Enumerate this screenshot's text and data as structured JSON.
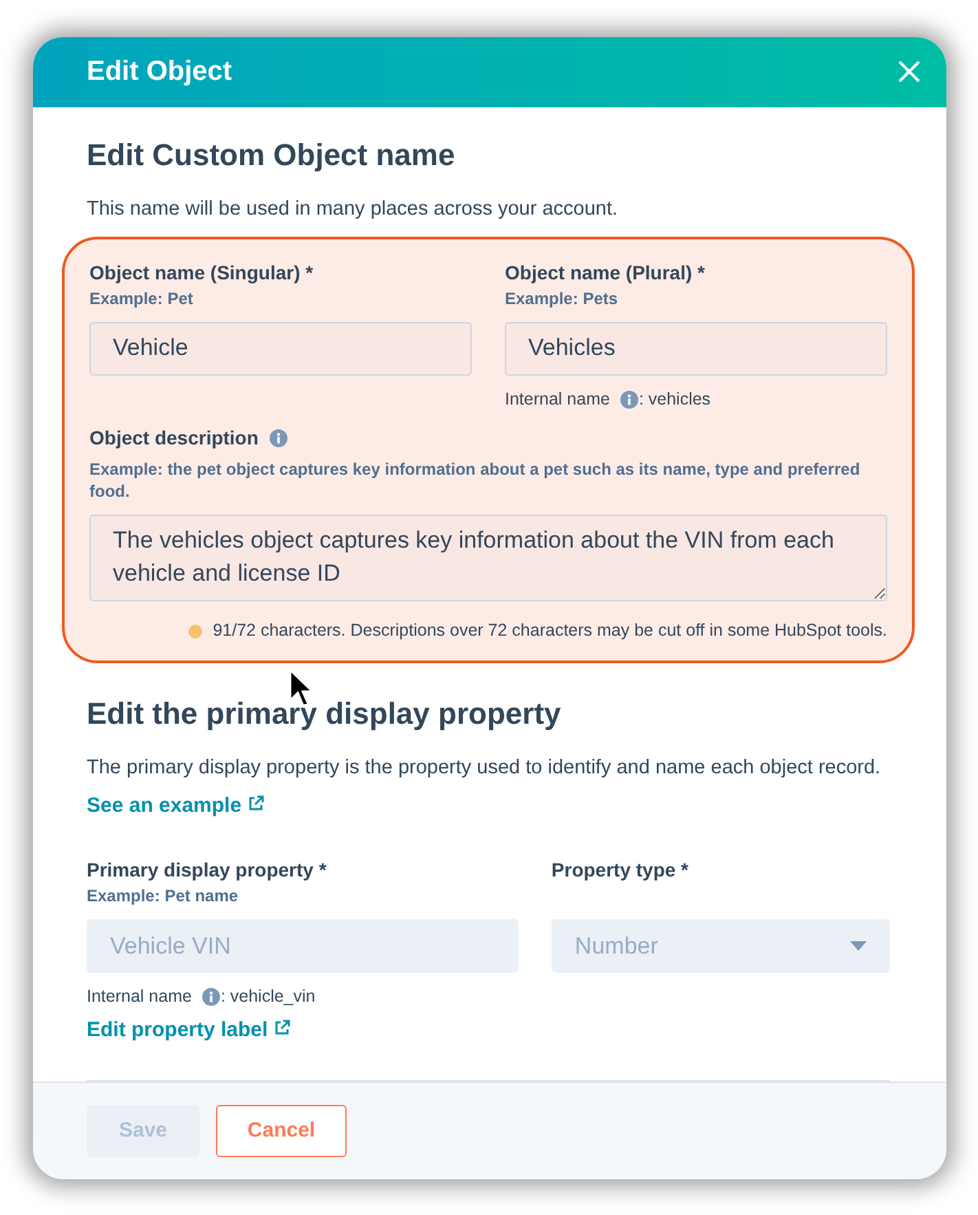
{
  "dialog": {
    "title": "Edit Object"
  },
  "name_section": {
    "heading": "Edit Custom Object name",
    "intro": "This name will be used in many places across your account.",
    "highlighted": true,
    "singular": {
      "label": "Object name (Singular) *",
      "example": "Example: Pet",
      "value": "Vehicle"
    },
    "plural": {
      "label": "Object name (Plural) *",
      "example": "Example: Pets",
      "value": "Vehicles",
      "internal_label": "Internal name",
      "internal_value": ": vehicles"
    },
    "description": {
      "label": "Object description",
      "example": "Example: the pet object captures key information about a pet such as its name, type and preferred food.",
      "value": "The vehicles object captures key information about the VIN from each vehicle and license ID",
      "color": "#f5c26b",
      "status": "91/72 characters. Descriptions over 72 characters may be cut off in some HubSpot tools."
    }
  },
  "display_section": {
    "heading": "Edit the primary display property",
    "intro": "The primary display property is the property used to identify and name each object record.",
    "link": "See an example",
    "property": {
      "label": "Primary display property *",
      "example": "Example: Pet name",
      "value": "Vehicle VIN",
      "disabled": true,
      "internal_label": "Internal name",
      "internal_value": ": vehicle_vin",
      "link": "Edit property label"
    },
    "type": {
      "label": "Property type *",
      "value": "Number",
      "disabled": true
    }
  },
  "footer": {
    "buttons": [
      {
        "label": "Save",
        "kind": "primary",
        "disabled": true
      },
      {
        "label": "Cancel",
        "kind": "secondary",
        "disabled": false
      }
    ]
  }
}
